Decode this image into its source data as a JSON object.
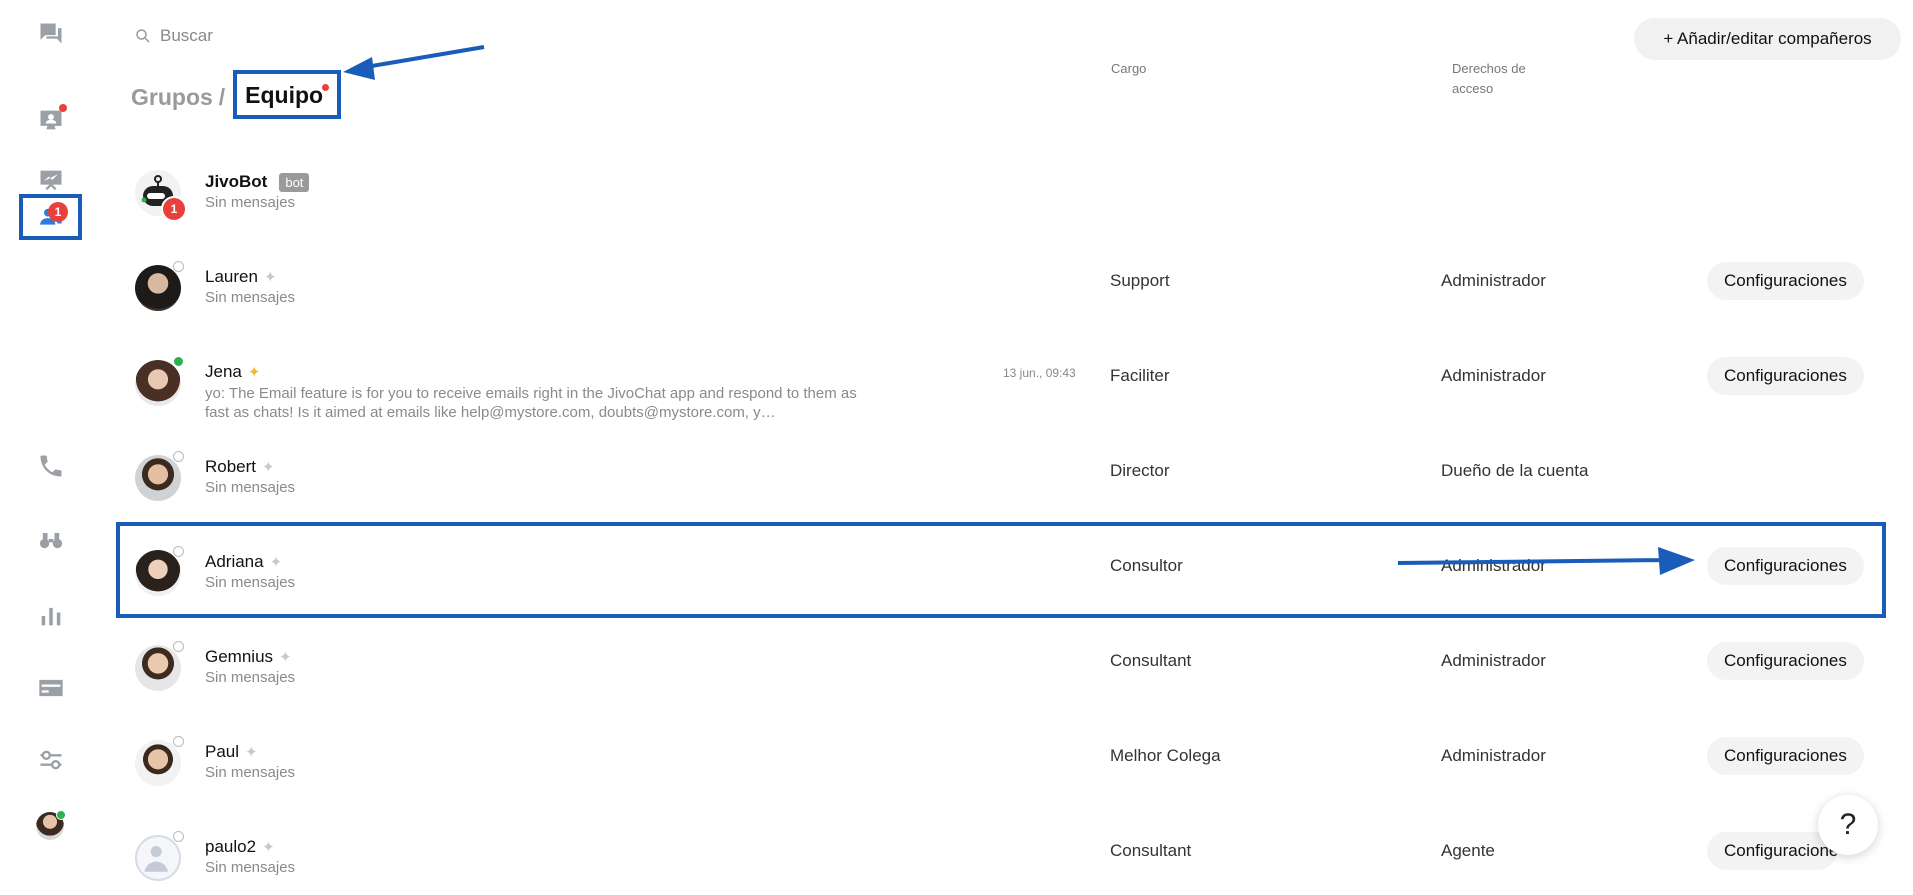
{
  "search": {
    "placeholder": "Buscar"
  },
  "breadcrumb": {
    "parent": "Grupos",
    "separator": "/",
    "current": "Equipo"
  },
  "columns": {
    "role": "Cargo",
    "access_line1": "Derechos de",
    "access_line2": "acceso"
  },
  "add_button": "+ Añadir/editar compañeros",
  "nav": {
    "team_badge_count": "1"
  },
  "bot": {
    "name": "JivoBot",
    "tag": "bot",
    "sub": "Sin mensajes",
    "badge_count": "1"
  },
  "members": [
    {
      "name": "Lauren",
      "sub": "Sin mensajes",
      "role": "Support",
      "access": "Administrador",
      "action": "Configuraciones"
    },
    {
      "name": "Jena",
      "preview": "yo: The Email feature is for you to receive emails right in the JivoChat app and respond to them as fast as chats! Is it aimed at emails like help@mystore.com, doubts@mystore.com, y…",
      "time": "13 jun., 09:43",
      "role": "Faciliter",
      "access": "Administrador",
      "action": "Configuraciones"
    },
    {
      "name": "Robert",
      "sub": "Sin mensajes",
      "role": "Director",
      "access": "Dueño de la cuenta",
      "action": ""
    },
    {
      "name": "Adriana",
      "sub": "Sin mensajes",
      "role": "Consultor",
      "access": "Administrador",
      "action": "Configuraciones"
    },
    {
      "name": "Gemnius",
      "sub": "Sin mensajes",
      "role": "Consultant",
      "access": "Administrador",
      "action": "Configuraciones"
    },
    {
      "name": "Paul",
      "sub": "Sin mensajes",
      "role": "Melhor Colega",
      "access": "Administrador",
      "action": "Configuraciones"
    },
    {
      "name": "paulo2",
      "sub": "Sin mensajes",
      "role": "Consultant",
      "access": "Agente",
      "action": "Configuraciones"
    }
  ],
  "help": "?",
  "colors": {
    "accent": "#1a5cba",
    "badge": "#e8413c",
    "online": "#2bb24c"
  }
}
